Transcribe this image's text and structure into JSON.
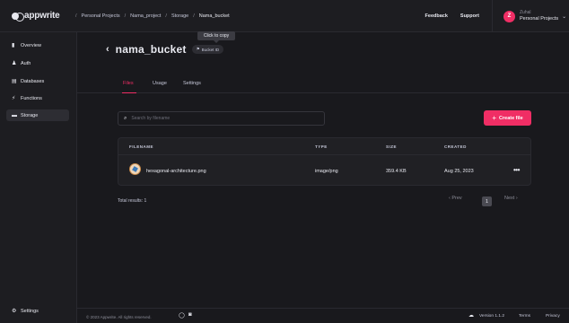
{
  "brand": {
    "logo_text": "appwrite"
  },
  "breadcrumbs": [
    "Personal Projects",
    "Nama_project",
    "Storage",
    "Nama_bucket"
  ],
  "breadcrumb_sep": "/",
  "header": {
    "feedback": "Feedback",
    "support": "Support"
  },
  "user": {
    "initial": "Z",
    "name": "Zuhal",
    "org": "Personal Projects",
    "chevron": "⌄"
  },
  "sidebar": {
    "items": [
      {
        "label": "Overview",
        "icon": "bar-chart-icon",
        "glyph": "▮"
      },
      {
        "label": "Auth",
        "icon": "users-icon",
        "glyph": "♟"
      },
      {
        "label": "Databases",
        "icon": "database-icon",
        "glyph": "▤"
      },
      {
        "label": "Functions",
        "icon": "lightning-icon",
        "glyph": "⚡"
      },
      {
        "label": "Storage",
        "icon": "folder-icon",
        "glyph": "▬"
      }
    ],
    "settings": {
      "label": "Settings",
      "glyph": "⚙"
    }
  },
  "tooltip": "Click to copy",
  "page": {
    "back": "‹",
    "title": "nama_bucket",
    "id_chip": "Bucket ID"
  },
  "tabs": [
    "Files",
    "Usage",
    "Settings"
  ],
  "search": {
    "placeholder": "Search by filename",
    "icon": "⌕"
  },
  "create_button": {
    "plus": "+",
    "label": "Create file"
  },
  "table": {
    "headers": [
      "FILENAME",
      "TYPE",
      "SIZE",
      "CREATED"
    ],
    "rows": [
      {
        "filename": "hexagonal-architecture.png",
        "type": "image/png",
        "size": "359.4 KB",
        "created": "Aug 25, 2023",
        "menu": "•••"
      }
    ]
  },
  "total": "Total results: 1",
  "pagination": {
    "prev": "‹  Prev",
    "current": "1",
    "next": "Next  ›"
  },
  "footer": {
    "copyright": "© 2023 Appwrite. All rights reserved.",
    "github": "◯",
    "discord": "◙",
    "cloud": "☁",
    "version": "Version 1.1.2",
    "terms": "Terms",
    "privacy": "Privacy"
  },
  "colors": {
    "accent": "#f02e65",
    "bg": "#19191d",
    "panel": "#1d1d21"
  }
}
